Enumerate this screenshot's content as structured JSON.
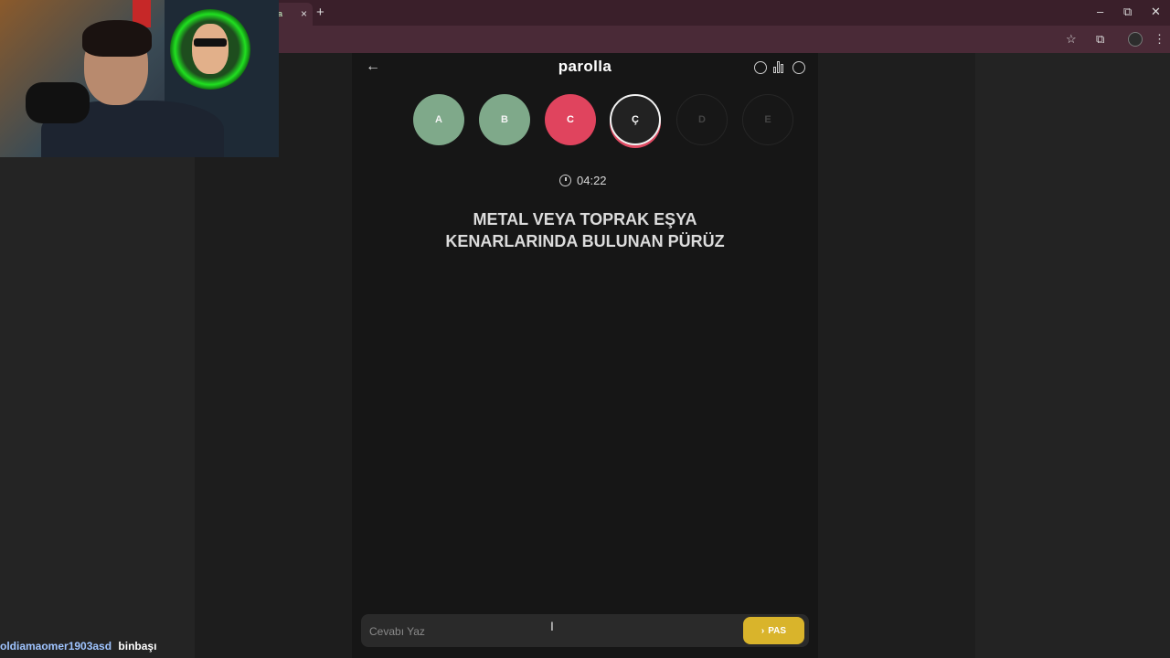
{
  "browser": {
    "tab_title": "a",
    "tab_close": "×",
    "new_tab": "+",
    "window_controls": [
      "–",
      "⧉",
      "✕"
    ],
    "toolbar_icons": [
      "star-icon",
      "extensions-icon",
      "profile-avatar",
      "menu-icon"
    ],
    "toolbar_glyphs": {
      "star": "☆",
      "extensions": "⧉",
      "menu": "⋮"
    }
  },
  "app": {
    "back_glyph": "←",
    "logo": "parolla",
    "letters": [
      {
        "label": "A",
        "state": "correct"
      },
      {
        "label": "B",
        "state": "correct"
      },
      {
        "label": "C",
        "state": "wrong"
      },
      {
        "label": "Ç",
        "state": "active"
      },
      {
        "label": "D",
        "state": "pending"
      },
      {
        "label": "E",
        "state": "pending"
      }
    ],
    "timer": "04:22",
    "question_line1": "METAL VEYA TOPRAK EŞYA",
    "question_line2": "KENARLARINDA BULUNAN PÜRÜZ",
    "answer_placeholder": "Cevabı Yaz",
    "pass_label": "PAS",
    "pass_glyph": "›"
  },
  "chat": {
    "username": "oldiamaomer1903asd",
    "message": "binbaşı"
  },
  "colors": {
    "correct": "#7fa98a",
    "wrong": "#e0445e",
    "accent": "#d9b42b",
    "chrome": "#4a2a37"
  }
}
